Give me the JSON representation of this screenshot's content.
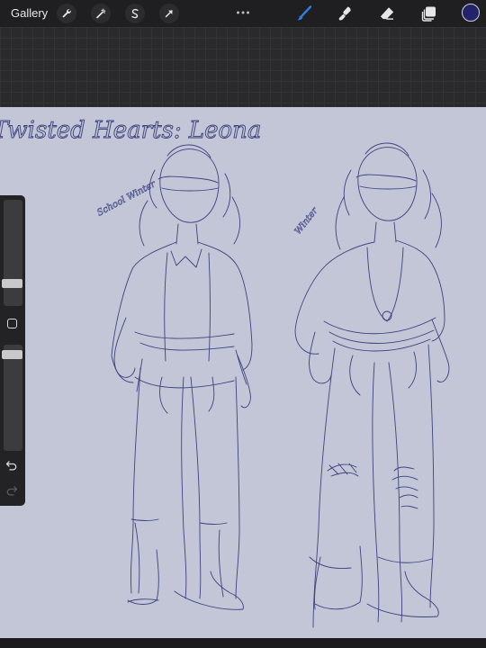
{
  "topbar": {
    "gallery_label": "Gallery",
    "left_tools": [
      "wrench-icon",
      "magic-wand-icon",
      "selection-icon",
      "transform-arrow-icon"
    ],
    "right_tools": [
      "brush-icon",
      "smudge-icon",
      "eraser-icon",
      "layers-icon"
    ],
    "active_tool": "brush",
    "active_tool_color": "#2f7de0",
    "current_color": "#24226a"
  },
  "canvas": {
    "background": "#c2c6d6",
    "title": "Twisted Hearts: Leona",
    "label_left": "School Winter",
    "label_right": "Winter",
    "stroke_color": "#3b3f7a"
  },
  "sidebar": {
    "brush_size_level": 0.72,
    "opacity_level": 0.05,
    "undo_icon": "undo-icon",
    "redo_icon": "redo-icon"
  }
}
